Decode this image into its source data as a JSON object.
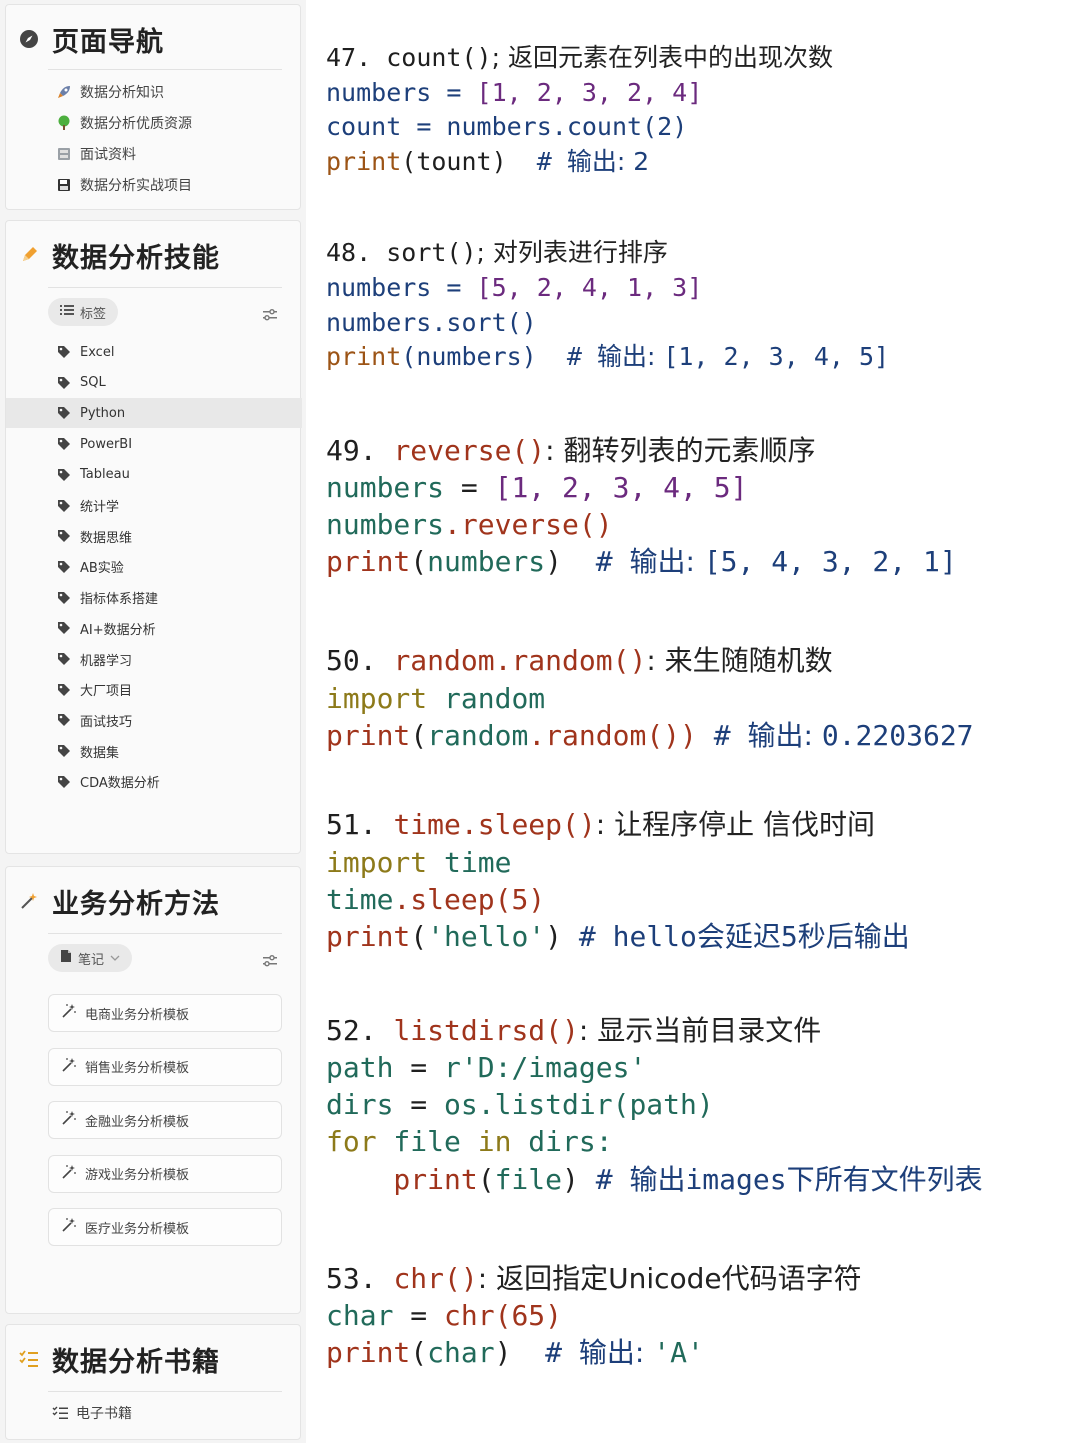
{
  "sidebar": {
    "nav": {
      "title": "页面导航",
      "items": [
        {
          "label": "数据分析知识",
          "icon": "rocket-icon"
        },
        {
          "label": "数据分析优质资源",
          "icon": "tree-icon"
        },
        {
          "label": "面试资料",
          "icon": "file-cabinet-icon"
        },
        {
          "label": "数据分析实战项目",
          "icon": "save-disk-icon"
        }
      ]
    },
    "skills": {
      "title": "数据分析技能",
      "chip_label": "标签",
      "tags": [
        "Excel",
        "SQL",
        "Python",
        "PowerBI",
        "Tableau",
        "统计学",
        "数据思维",
        "AB实验",
        "指标体系搭建",
        "AI+数据分析",
        "机器学习",
        "大厂项目",
        "面试技巧",
        "数据集",
        "CDA数据分析"
      ],
      "active_tag": "Python"
    },
    "methods": {
      "title": "业务分析方法",
      "chip_label": "笔记",
      "templates": [
        "电商业务分析模板",
        "销售业务分析模板",
        "金融业务分析模板",
        "游戏业务分析模板",
        "医疗业务分析模板"
      ]
    },
    "books": {
      "title": "数据分析书籍",
      "items": [
        "电子书籍"
      ]
    }
  },
  "code": {
    "b47": {
      "head_num": "47. ",
      "head_fn": "count()",
      "head_sep": "; ",
      "head_desc": "返回元素在列表中的出现次数",
      "l1": [
        "numbers",
        " = ",
        "[1, 2, 3, 2, 4]"
      ],
      "l2": [
        "count",
        " = ",
        "numbers.count(2)"
      ],
      "l3": [
        "print",
        "(tount)",
        "  # ",
        "输出: 2"
      ]
    },
    "b48": {
      "head_num": "48. ",
      "head_fn": "sort()",
      "head_sep": "; ",
      "head_desc": "对列表进行排序",
      "l1": [
        "numbers",
        " = ",
        "[5, 2, 4, 1, 3]"
      ],
      "l2": [
        "numbers.sort()"
      ],
      "l3": [
        "print",
        "(numbers)",
        "  # ",
        "输出: ",
        "[1, 2, 3, 4, 5]"
      ]
    },
    "b49": {
      "head_num": "49. ",
      "head_fn": "reverse()",
      "head_sep": ": ",
      "head_desc": "翻转列表的元素顺序",
      "l1": [
        "numbers",
        " = ",
        "[1, 2, 3, 4, 5]"
      ],
      "l2": [
        "numbers",
        ".reverse()"
      ],
      "l3": [
        "print",
        "(",
        "numbers",
        ")",
        "  # ",
        "输出: ",
        "[5, 4, 3, 2, 1]"
      ]
    },
    "b50": {
      "head_num": "50. ",
      "head_fn": "random.random()",
      "head_sep": ": ",
      "head_desc": "来生随随机数",
      "l1": [
        "import",
        " random"
      ],
      "l2": [
        "print",
        "(",
        "random",
        ".random())",
        " # ",
        "输出: ",
        "0.2203627"
      ]
    },
    "b51": {
      "head_num": "51. ",
      "head_fn": "time.sleep()",
      "head_sep": ": ",
      "head_desc": "让程序停止 信伐时间",
      "l1": [
        "import",
        " time"
      ],
      "l2": [
        "time",
        ".sleep(5)"
      ],
      "l3": [
        "print",
        "(",
        "'hello'",
        ")",
        " # ",
        "hello会延迟5秒后输出"
      ]
    },
    "b52": {
      "head_num": "52. ",
      "head_fn": "listdirsd()",
      "head_sep": ": ",
      "head_desc": "显示当前目录文件",
      "l1": [
        "path",
        " = ",
        "r'D:/images'"
      ],
      "l2": [
        "dirs",
        " = ",
        "os.listdir(path)"
      ],
      "l3": [
        "for",
        " file ",
        "in",
        " dirs:"
      ],
      "l4": [
        "    print",
        "(",
        "file",
        ")",
        " # ",
        "输出images下所有文件列表"
      ]
    },
    "b53": {
      "head_num": "53. ",
      "head_fn": "chr()",
      "head_sep": ": ",
      "head_desc": "返回指定Unicode代码语字符",
      "l1": [
        "char",
        " = ",
        "chr(65)"
      ],
      "l2": [
        "print",
        "(",
        "char",
        ")",
        "  # ",
        "输出: ",
        "'A'"
      ]
    }
  }
}
